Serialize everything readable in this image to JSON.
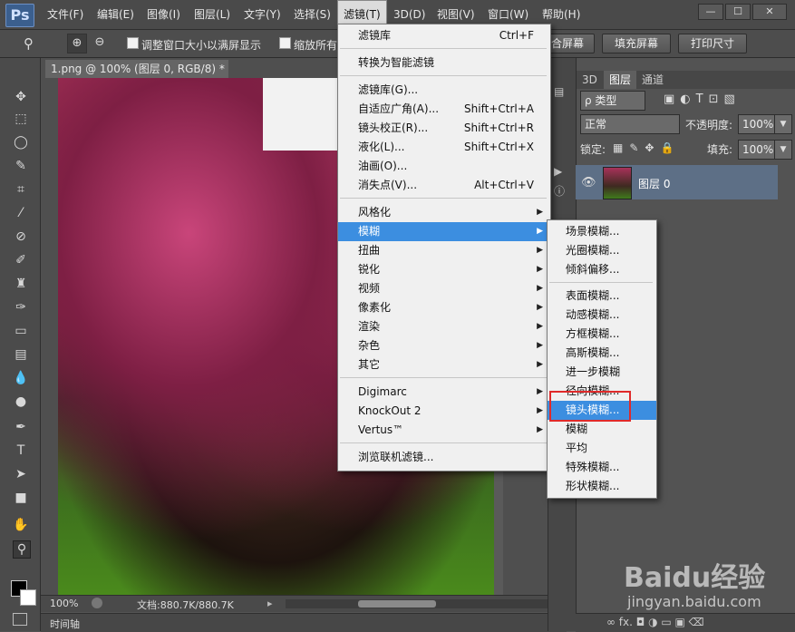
{
  "app": {
    "logo": "Ps"
  },
  "menubar": {
    "items": [
      "文件(F)",
      "编辑(E)",
      "图像(I)",
      "图层(L)",
      "文字(Y)",
      "选择(S)",
      "滤镜(T)",
      "3D(D)",
      "视图(V)",
      "窗口(W)",
      "帮助(H)"
    ],
    "window_buttons": [
      "—",
      "☐",
      "✕"
    ]
  },
  "options": {
    "checkbox1": "调整窗口大小以满屏显示",
    "checkbox2": "缩放所有",
    "btn_fit": "合屏幕",
    "btn_fill": "填充屏幕",
    "btn_print": "打印尺寸"
  },
  "document": {
    "tab_title": "1.png @ 100% (图层 0, RGB/8) *",
    "close": "×",
    "zoom": "100%",
    "doc_size": "文档:880.7K/880.7K",
    "timeline": "时间轴"
  },
  "filter_menu": {
    "top": [
      {
        "label": "滤镜库",
        "shortcut": "Ctrl+F"
      }
    ],
    "smart": [
      {
        "label": "转换为智能滤镜"
      }
    ],
    "group1": [
      {
        "label": "滤镜库(G)..."
      },
      {
        "label": "自适应广角(A)...",
        "shortcut": "Shift+Ctrl+A"
      },
      {
        "label": "镜头校正(R)...",
        "shortcut": "Shift+Ctrl+R"
      },
      {
        "label": "液化(L)...",
        "shortcut": "Shift+Ctrl+X"
      },
      {
        "label": "油画(O)..."
      },
      {
        "label": "消失点(V)...",
        "shortcut": "Alt+Ctrl+V"
      }
    ],
    "group2": [
      "风格化",
      "模糊",
      "扭曲",
      "锐化",
      "视频",
      "像素化",
      "渲染",
      "杂色",
      "其它"
    ],
    "group3": [
      "Digimarc",
      "KnockOut 2",
      "Vertus™"
    ],
    "browse": "浏览联机滤镜..."
  },
  "blur_menu": {
    "group1": [
      "场景模糊...",
      "光圈模糊...",
      "倾斜偏移..."
    ],
    "group2": [
      "表面模糊...",
      "动感模糊...",
      "方框模糊...",
      "高斯模糊...",
      "进一步模糊",
      "径向模糊...",
      "镜头模糊...",
      "模糊",
      "平均",
      "特殊模糊...",
      "形状模糊..."
    ]
  },
  "layers_panel": {
    "tabs": [
      "3D",
      "图层",
      "通道"
    ],
    "kind": "ρ 类型",
    "blend": "正常",
    "opacity_label": "不透明度:",
    "opacity": "100%",
    "lock_label": "锁定:",
    "fill_label": "填充:",
    "fill": "100%",
    "layer_name": "图层 0",
    "bottom_icons": "∞  fx.  ◘  ◑  ▭  ▣  ⌫"
  },
  "watermark": {
    "logo": "Baidu经验",
    "url": "jingyan.baidu.com"
  },
  "colors": {
    "highlight": "#3c8ee0",
    "annotation": "#e02a2a"
  }
}
